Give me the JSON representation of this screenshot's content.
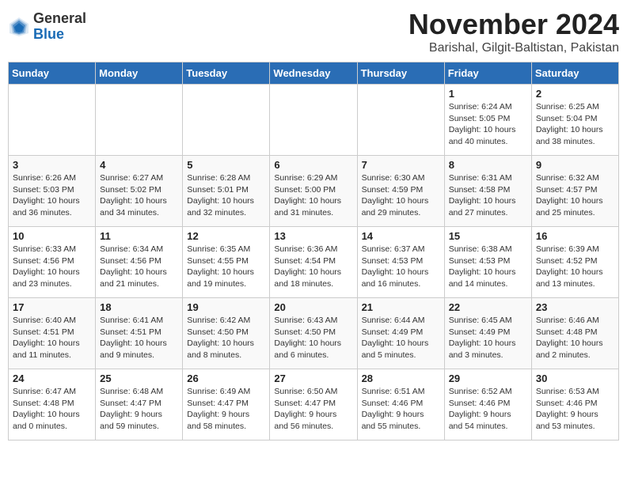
{
  "logo": {
    "general": "General",
    "blue": "Blue"
  },
  "title": "November 2024",
  "location": "Barishal, Gilgit-Baltistan, Pakistan",
  "weekdays": [
    "Sunday",
    "Monday",
    "Tuesday",
    "Wednesday",
    "Thursday",
    "Friday",
    "Saturday"
  ],
  "weeks": [
    [
      {
        "day": "",
        "info": ""
      },
      {
        "day": "",
        "info": ""
      },
      {
        "day": "",
        "info": ""
      },
      {
        "day": "",
        "info": ""
      },
      {
        "day": "",
        "info": ""
      },
      {
        "day": "1",
        "info": "Sunrise: 6:24 AM\nSunset: 5:05 PM\nDaylight: 10 hours\nand 40 minutes."
      },
      {
        "day": "2",
        "info": "Sunrise: 6:25 AM\nSunset: 5:04 PM\nDaylight: 10 hours\nand 38 minutes."
      }
    ],
    [
      {
        "day": "3",
        "info": "Sunrise: 6:26 AM\nSunset: 5:03 PM\nDaylight: 10 hours\nand 36 minutes."
      },
      {
        "day": "4",
        "info": "Sunrise: 6:27 AM\nSunset: 5:02 PM\nDaylight: 10 hours\nand 34 minutes."
      },
      {
        "day": "5",
        "info": "Sunrise: 6:28 AM\nSunset: 5:01 PM\nDaylight: 10 hours\nand 32 minutes."
      },
      {
        "day": "6",
        "info": "Sunrise: 6:29 AM\nSunset: 5:00 PM\nDaylight: 10 hours\nand 31 minutes."
      },
      {
        "day": "7",
        "info": "Sunrise: 6:30 AM\nSunset: 4:59 PM\nDaylight: 10 hours\nand 29 minutes."
      },
      {
        "day": "8",
        "info": "Sunrise: 6:31 AM\nSunset: 4:58 PM\nDaylight: 10 hours\nand 27 minutes."
      },
      {
        "day": "9",
        "info": "Sunrise: 6:32 AM\nSunset: 4:57 PM\nDaylight: 10 hours\nand 25 minutes."
      }
    ],
    [
      {
        "day": "10",
        "info": "Sunrise: 6:33 AM\nSunset: 4:56 PM\nDaylight: 10 hours\nand 23 minutes."
      },
      {
        "day": "11",
        "info": "Sunrise: 6:34 AM\nSunset: 4:56 PM\nDaylight: 10 hours\nand 21 minutes."
      },
      {
        "day": "12",
        "info": "Sunrise: 6:35 AM\nSunset: 4:55 PM\nDaylight: 10 hours\nand 19 minutes."
      },
      {
        "day": "13",
        "info": "Sunrise: 6:36 AM\nSunset: 4:54 PM\nDaylight: 10 hours\nand 18 minutes."
      },
      {
        "day": "14",
        "info": "Sunrise: 6:37 AM\nSunset: 4:53 PM\nDaylight: 10 hours\nand 16 minutes."
      },
      {
        "day": "15",
        "info": "Sunrise: 6:38 AM\nSunset: 4:53 PM\nDaylight: 10 hours\nand 14 minutes."
      },
      {
        "day": "16",
        "info": "Sunrise: 6:39 AM\nSunset: 4:52 PM\nDaylight: 10 hours\nand 13 minutes."
      }
    ],
    [
      {
        "day": "17",
        "info": "Sunrise: 6:40 AM\nSunset: 4:51 PM\nDaylight: 10 hours\nand 11 minutes."
      },
      {
        "day": "18",
        "info": "Sunrise: 6:41 AM\nSunset: 4:51 PM\nDaylight: 10 hours\nand 9 minutes."
      },
      {
        "day": "19",
        "info": "Sunrise: 6:42 AM\nSunset: 4:50 PM\nDaylight: 10 hours\nand 8 minutes."
      },
      {
        "day": "20",
        "info": "Sunrise: 6:43 AM\nSunset: 4:50 PM\nDaylight: 10 hours\nand 6 minutes."
      },
      {
        "day": "21",
        "info": "Sunrise: 6:44 AM\nSunset: 4:49 PM\nDaylight: 10 hours\nand 5 minutes."
      },
      {
        "day": "22",
        "info": "Sunrise: 6:45 AM\nSunset: 4:49 PM\nDaylight: 10 hours\nand 3 minutes."
      },
      {
        "day": "23",
        "info": "Sunrise: 6:46 AM\nSunset: 4:48 PM\nDaylight: 10 hours\nand 2 minutes."
      }
    ],
    [
      {
        "day": "24",
        "info": "Sunrise: 6:47 AM\nSunset: 4:48 PM\nDaylight: 10 hours\nand 0 minutes."
      },
      {
        "day": "25",
        "info": "Sunrise: 6:48 AM\nSunset: 4:47 PM\nDaylight: 9 hours\nand 59 minutes."
      },
      {
        "day": "26",
        "info": "Sunrise: 6:49 AM\nSunset: 4:47 PM\nDaylight: 9 hours\nand 58 minutes."
      },
      {
        "day": "27",
        "info": "Sunrise: 6:50 AM\nSunset: 4:47 PM\nDaylight: 9 hours\nand 56 minutes."
      },
      {
        "day": "28",
        "info": "Sunrise: 6:51 AM\nSunset: 4:46 PM\nDaylight: 9 hours\nand 55 minutes."
      },
      {
        "day": "29",
        "info": "Sunrise: 6:52 AM\nSunset: 4:46 PM\nDaylight: 9 hours\nand 54 minutes."
      },
      {
        "day": "30",
        "info": "Sunrise: 6:53 AM\nSunset: 4:46 PM\nDaylight: 9 hours\nand 53 minutes."
      }
    ]
  ]
}
